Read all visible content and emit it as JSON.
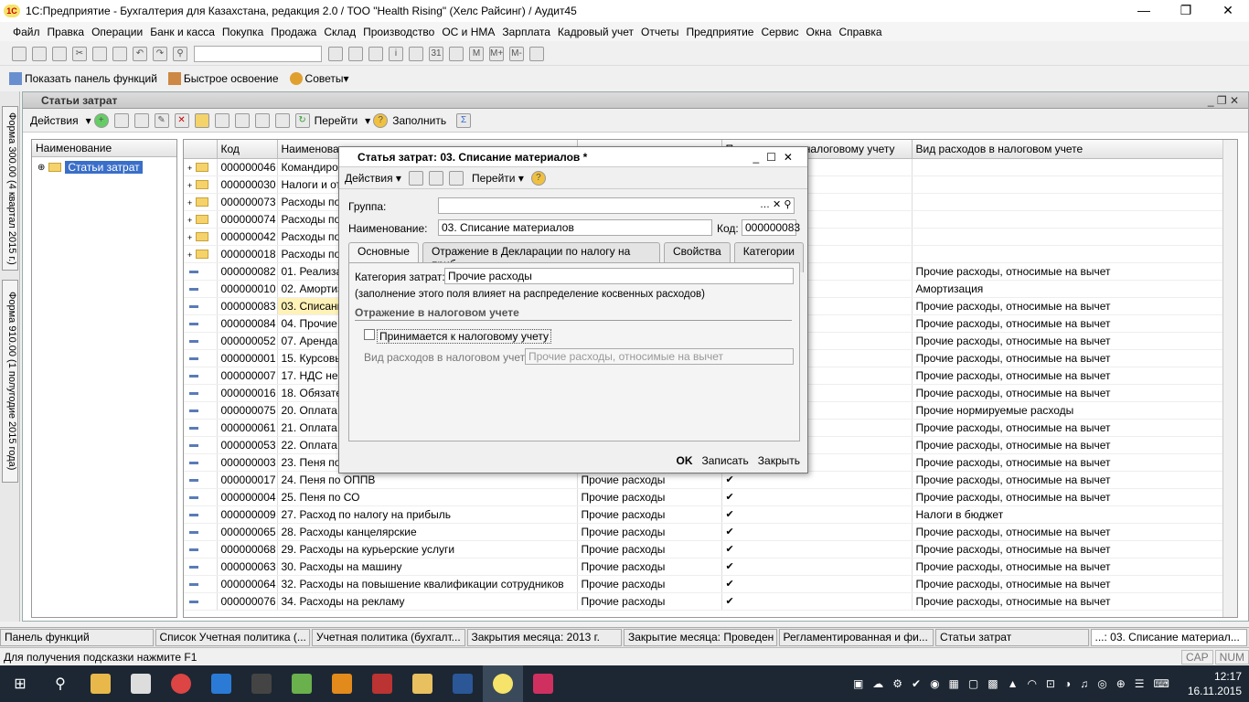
{
  "window": {
    "title": "1С:Предприятие - Бухгалтерия для Казахстана, редакция 2.0 / ТОО \"Health Rising\" (Хелс Райсинг) / Аудит45"
  },
  "menu": [
    "Файл",
    "Правка",
    "Операции",
    "Банк и касса",
    "Покупка",
    "Продажа",
    "Склад",
    "Производство",
    "ОС и НМА",
    "Зарплата",
    "Кадровый учет",
    "Отчеты",
    "Предприятие",
    "Сервис",
    "Окна",
    "Справка"
  ],
  "toolbar2": {
    "show_panel": "Показать панель функций",
    "quick_learn": "Быстрое освоение",
    "tips": "Советы"
  },
  "left_tabs": [
    "Форма 300.00 (4 квартал 2015 г.)",
    "Форма 910.00 (1 полугодие 2015 года)"
  ],
  "main": {
    "title": "Статьи затрат",
    "actions": "Действия",
    "goto": "Перейти",
    "fill": "Заполнить",
    "tree_header": "Наименование",
    "tree_root": "Статьи затрат",
    "columns": [
      "Код",
      "Наименование",
      "",
      "Принимается к налоговому учету",
      "Вид расходов в налоговом учете"
    ],
    "rows": [
      {
        "code": "000000046",
        "name": "Командиров",
        "cat": "",
        "check": "",
        "tax": "",
        "type": "folder"
      },
      {
        "code": "000000030",
        "name": "Налоги и от",
        "cat": "",
        "check": "",
        "tax": "",
        "type": "folder"
      },
      {
        "code": "000000073",
        "name": "Расходы по",
        "cat": "",
        "check": "",
        "tax": "",
        "type": "folder"
      },
      {
        "code": "000000074",
        "name": "Расходы по",
        "cat": "",
        "check": "",
        "tax": "",
        "type": "folder"
      },
      {
        "code": "000000042",
        "name": "Расходы по",
        "cat": "",
        "check": "",
        "tax": "",
        "type": "folder"
      },
      {
        "code": "000000018",
        "name": "Расходы по",
        "cat": "",
        "check": "",
        "tax": "",
        "type": "folder"
      },
      {
        "code": "000000082",
        "name": "01. Реализа",
        "cat": "",
        "check": "",
        "tax": "Прочие расходы, относимые на вычет",
        "type": "item"
      },
      {
        "code": "000000010",
        "name": "02. Амортиз",
        "cat": "",
        "check": "",
        "tax": "Амортизация",
        "type": "item"
      },
      {
        "code": "000000083",
        "name": "03. Списани",
        "cat": "",
        "check": "",
        "tax": "Прочие расходы, относимые на вычет",
        "type": "item"
      },
      {
        "code": "000000084",
        "name": "04. Прочие р",
        "cat": "",
        "check": "",
        "tax": "Прочие расходы, относимые на вычет",
        "type": "item"
      },
      {
        "code": "000000052",
        "name": "07. Аренда о",
        "cat": "",
        "check": "",
        "tax": "Прочие расходы, относимые на вычет",
        "type": "item"
      },
      {
        "code": "000000001",
        "name": "15. Курсовь",
        "cat": "",
        "check": "",
        "tax": "Прочие расходы, относимые на вычет",
        "type": "item"
      },
      {
        "code": "000000007",
        "name": "17. НДС не",
        "cat": "",
        "check": "",
        "tax": "Прочие расходы, относимые на вычет",
        "type": "item"
      },
      {
        "code": "000000016",
        "name": "18. Обязате",
        "cat": "",
        "check": "",
        "tax": "Прочие расходы, относимые на вычет",
        "type": "item"
      },
      {
        "code": "000000075",
        "name": "20. Оплата у",
        "cat": "",
        "check": "",
        "tax": "Прочие нормируемые расходы",
        "type": "item"
      },
      {
        "code": "000000061",
        "name": "21. Оплата у",
        "cat": "",
        "check": "",
        "tax": "Прочие расходы, относимые на вычет",
        "type": "item"
      },
      {
        "code": "000000053",
        "name": "22. Оплата у",
        "cat": "",
        "check": "",
        "tax": "Прочие расходы, относимые на вычет",
        "type": "item"
      },
      {
        "code": "000000003",
        "name": "23. Пеня по",
        "cat": "",
        "check": "",
        "tax": "Прочие расходы, относимые на вычет",
        "type": "item"
      },
      {
        "code": "000000017",
        "name": "24. Пеня по ОППВ",
        "cat": "Прочие расходы",
        "check": "✔",
        "tax": "Прочие расходы, относимые на вычет",
        "type": "item"
      },
      {
        "code": "000000004",
        "name": "25. Пеня по СО",
        "cat": "Прочие расходы",
        "check": "✔",
        "tax": "Прочие расходы, относимые на вычет",
        "type": "item"
      },
      {
        "code": "000000009",
        "name": "27. Расход по налогу на прибыль",
        "cat": "Прочие расходы",
        "check": "✔",
        "tax": "Налоги в бюджет",
        "type": "item"
      },
      {
        "code": "000000065",
        "name": "28. Расходы канцелярские",
        "cat": "Прочие расходы",
        "check": "✔",
        "tax": "Прочие расходы, относимые на вычет",
        "type": "item"
      },
      {
        "code": "000000068",
        "name": "29. Расходы на курьерские услуги",
        "cat": "Прочие расходы",
        "check": "✔",
        "tax": "Прочие расходы, относимые на вычет",
        "type": "item"
      },
      {
        "code": "000000063",
        "name": "30. Расходы на машину",
        "cat": "Прочие расходы",
        "check": "✔",
        "tax": "Прочие расходы, относимые на вычет",
        "type": "item"
      },
      {
        "code": "000000064",
        "name": "32. Расходы на повышение квалификации сотрудников",
        "cat": "Прочие расходы",
        "check": "✔",
        "tax": "Прочие расходы, относимые на вычет",
        "type": "item"
      },
      {
        "code": "000000076",
        "name": "34. Расходы на рекламу",
        "cat": "Прочие расходы",
        "check": "✔",
        "tax": "Прочие расходы, относимые на вычет",
        "type": "item"
      }
    ]
  },
  "dialog": {
    "title": "Статья затрат: 03. Списание материалов *",
    "actions": "Действия",
    "goto": "Перейти",
    "group_label": "Группа:",
    "group_value": "",
    "name_label": "Наименование:",
    "name_value": "03. Списание материалов",
    "code_label": "Код:",
    "code_value": "000000083",
    "tabs": [
      "Основные",
      "Отражение в Декларации по налогу на приб...",
      "Свойства",
      "Категории"
    ],
    "category_label": "Категория затрат:",
    "category_value": "Прочие расходы",
    "note": "(заполнение этого поля влияет на распределение косвенных расходов)",
    "section": "Отражение в налоговом учете",
    "accepted_label": "Принимается к налоговому учету",
    "tax_type_label": "Вид расходов в налоговом учете:",
    "tax_type_placeholder": "Прочие расходы, относимые на вычет",
    "ok": "OK",
    "save": "Записать",
    "close": "Закрыть"
  },
  "taskbar1c": [
    "Панель функций",
    "Список Учетная политика (...",
    "Учетная политика (бухгалт...",
    "Закрытия месяца: 2013 г.",
    "Закрытие месяца: Проведен",
    "Регламентированная и фи...",
    "Статьи затрат",
    "...: 03. Списание материал..."
  ],
  "status": {
    "hint": "Для получения подсказки нажмите F1",
    "cap": "CAP",
    "num": "NUM"
  },
  "clock": {
    "time": "12:17",
    "date": "16.11.2015"
  }
}
